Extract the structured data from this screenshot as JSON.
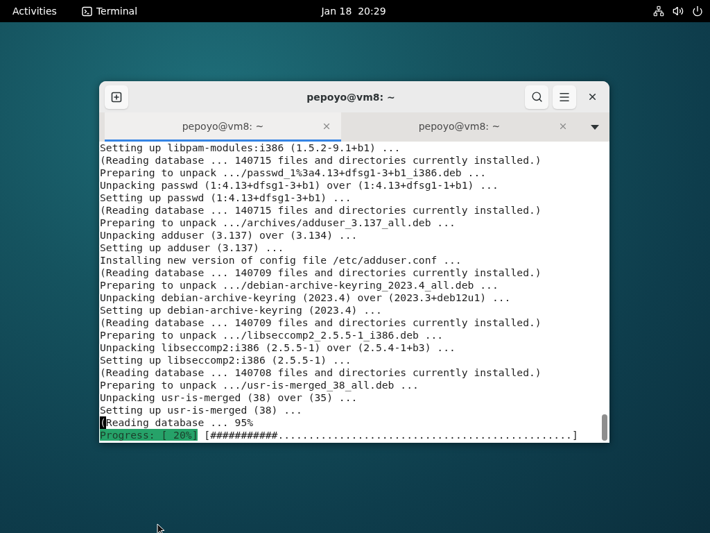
{
  "top_bar": {
    "activities": "Activities",
    "app": "Terminal",
    "clock": "Jan 18  20:29"
  },
  "window": {
    "title": "pepoyo@vm8: ~",
    "tabs": [
      {
        "label": "pepoyo@vm8: ~",
        "selected": true
      },
      {
        "label": "pepoyo@vm8: ~",
        "selected": false
      }
    ],
    "terminal": {
      "lines": [
        {
          "kind": "text",
          "text": "Setting up libpam-modules:i386 (1.5.2-9.1+b1) ...",
          "cursor": false
        },
        {
          "kind": "text",
          "text": "(Reading database ... 140715 files and directories currently installed.)",
          "cursor": false
        },
        {
          "kind": "text",
          "text": "Preparing to unpack .../passwd_1%3a4.13+dfsg1-3+b1_i386.deb ...",
          "cursor": false
        },
        {
          "kind": "text",
          "text": "Unpacking passwd (1:4.13+dfsg1-3+b1) over (1:4.13+dfsg1-1+b1) ...",
          "cursor": false
        },
        {
          "kind": "text",
          "text": "Setting up passwd (1:4.13+dfsg1-3+b1) ...",
          "cursor": false
        },
        {
          "kind": "text",
          "text": "(Reading database ... 140715 files and directories currently installed.)",
          "cursor": false
        },
        {
          "kind": "text",
          "text": "Preparing to unpack .../archives/adduser_3.137_all.deb ...",
          "cursor": false
        },
        {
          "kind": "text",
          "text": "Unpacking adduser (3.137) over (3.134) ...",
          "cursor": false
        },
        {
          "kind": "text",
          "text": "Setting up adduser (3.137) ...",
          "cursor": false
        },
        {
          "kind": "text",
          "text": "Installing new version of config file /etc/adduser.conf ...",
          "cursor": false
        },
        {
          "kind": "text",
          "text": "(Reading database ... 140709 files and directories currently installed.)",
          "cursor": false
        },
        {
          "kind": "text",
          "text": "Preparing to unpack .../debian-archive-keyring_2023.4_all.deb ...",
          "cursor": false
        },
        {
          "kind": "text",
          "text": "Unpacking debian-archive-keyring (2023.4) over (2023.3+deb12u1) ...",
          "cursor": false
        },
        {
          "kind": "text",
          "text": "Setting up debian-archive-keyring (2023.4) ...",
          "cursor": false
        },
        {
          "kind": "text",
          "text": "(Reading database ... 140709 files and directories currently installed.)",
          "cursor": false
        },
        {
          "kind": "text",
          "text": "Preparing to unpack .../libseccomp2_2.5.5-1_i386.deb ...",
          "cursor": false
        },
        {
          "kind": "text",
          "text": "Unpacking libseccomp2:i386 (2.5.5-1) over (2.5.4-1+b3) ...",
          "cursor": false
        },
        {
          "kind": "text",
          "text": "Setting up libseccomp2:i386 (2.5.5-1) ...",
          "cursor": false
        },
        {
          "kind": "text",
          "text": "(Reading database ... 140708 files and directories currently installed.)",
          "cursor": false
        },
        {
          "kind": "text",
          "text": "Preparing to unpack .../usr-is-merged_38_all.deb ...",
          "cursor": false
        },
        {
          "kind": "text",
          "text": "Unpacking usr-is-merged (38) over (35) ...",
          "cursor": false
        },
        {
          "kind": "text",
          "text": "Setting up usr-is-merged (38) ...",
          "cursor": false
        },
        {
          "kind": "text",
          "text": "(Reading database ... 95%",
          "cursor": true
        },
        {
          "kind": "progress",
          "label": "Progress: [ 20%]",
          "bar": "[###########................................................]"
        }
      ]
    }
  }
}
